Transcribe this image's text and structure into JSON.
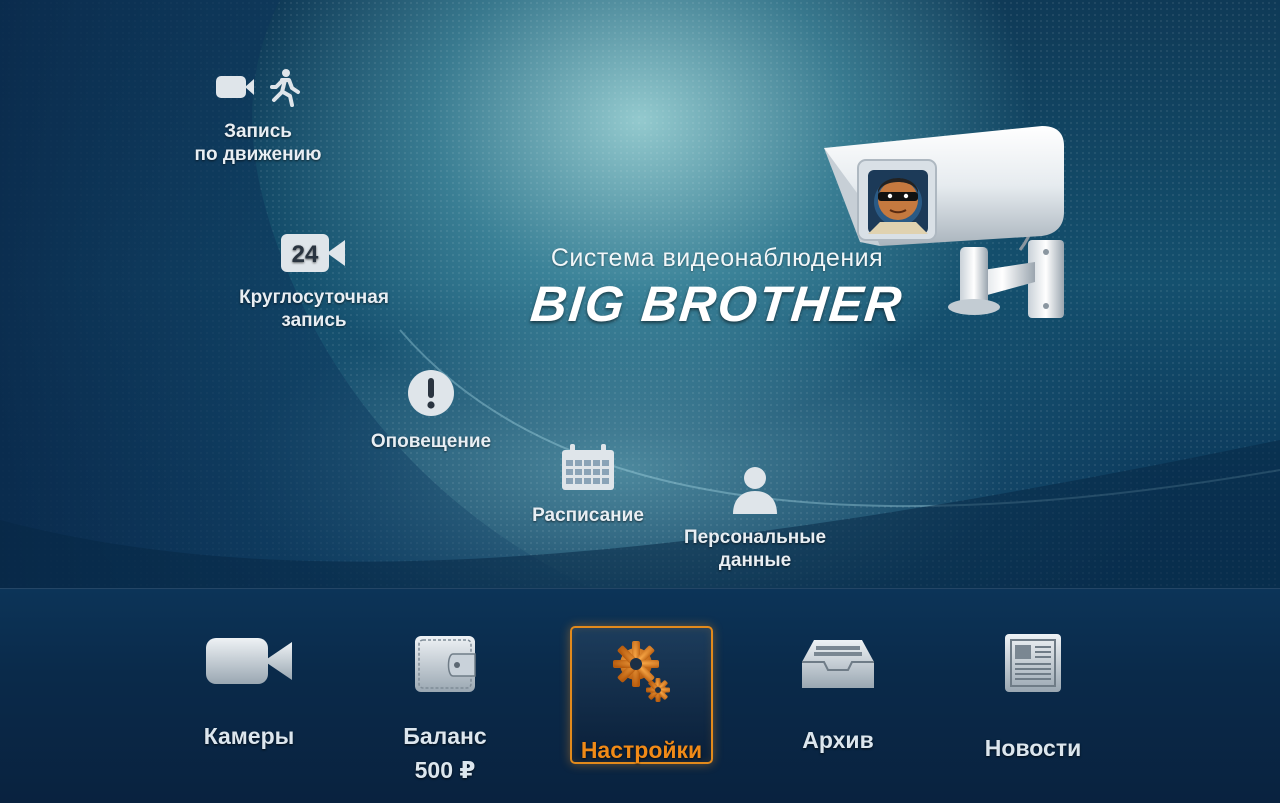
{
  "hero": {
    "subtitle": "Система видеонаблюдения",
    "title": "BIG BROTHER"
  },
  "features": [
    {
      "line1": "Запись",
      "line2": "по движению",
      "icon": "motion-record-icon"
    },
    {
      "line1": "Круглосуточная",
      "line2": "запись",
      "icon": "24h-record-icon",
      "badge": "24"
    },
    {
      "line1": "Оповещение",
      "icon": "alert-icon"
    },
    {
      "line1": "Расписание",
      "icon": "calendar-icon"
    },
    {
      "line1": "Персональные",
      "line2": "данные",
      "icon": "user-icon"
    }
  ],
  "nav": {
    "active": "Настройки",
    "items": [
      {
        "label": "Камеры",
        "icon": "video-camera-icon"
      },
      {
        "label": "Баланс",
        "value": "500 ₽",
        "icon": "wallet-icon"
      },
      {
        "label": "Настройки",
        "icon": "gears-icon"
      },
      {
        "label": "Архив",
        "icon": "archive-tray-icon"
      },
      {
        "label": "Новости",
        "icon": "newspaper-icon"
      }
    ]
  },
  "colors": {
    "accent": "#e28a1c",
    "background": "#0c3458",
    "text": "#dce6ee"
  }
}
